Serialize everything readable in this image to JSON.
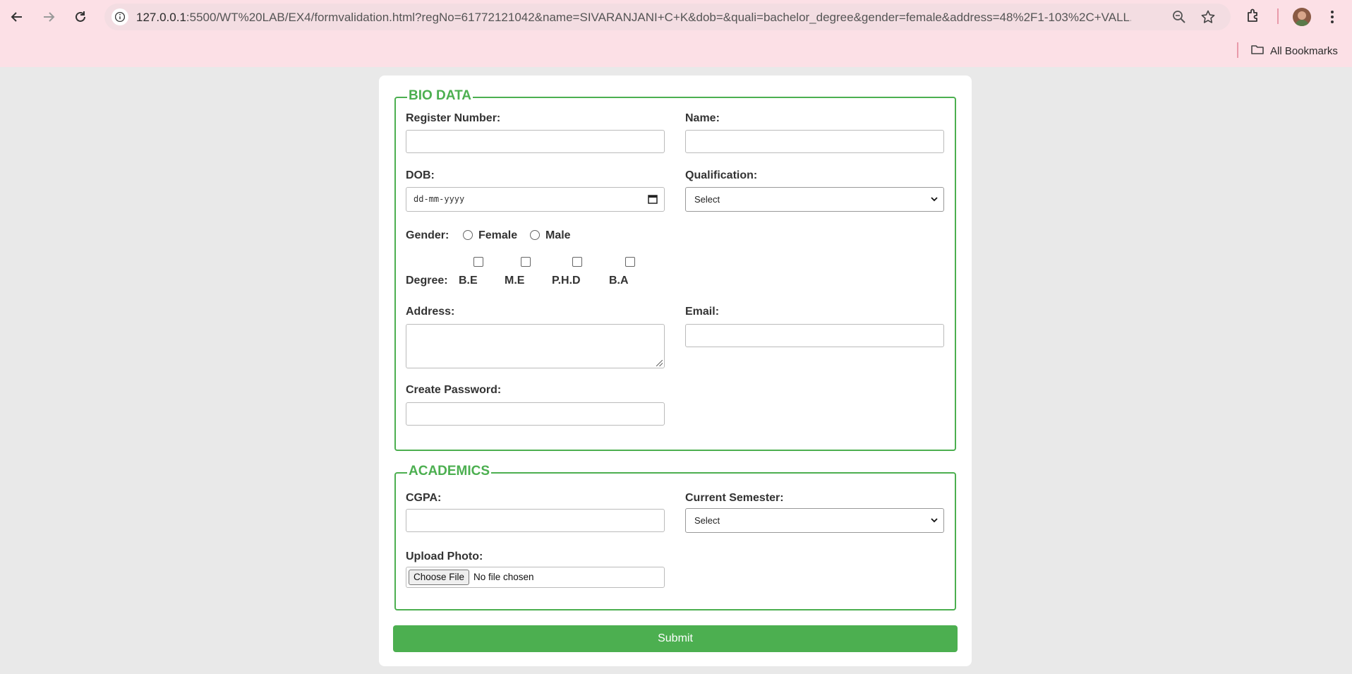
{
  "browser": {
    "url_host": "127.0.0.1",
    "url_rest": ":5500/WT%20LAB/EX4/formvalidation.html?regNo=61772121042&name=SIVARANJANI+C+K&dob=&quali=bachelor_degree&gender=female&address=48%2F1-103%2C+VALL...",
    "bookmarks_label": "All Bookmarks",
    "icons": [
      "back-icon",
      "forward-icon",
      "reload-icon",
      "site-info-icon",
      "zoom-icon",
      "star-icon",
      "extensions-icon",
      "folder-icon",
      "kebab-menu-icon"
    ]
  },
  "form": {
    "biodata": {
      "legend": "BIO DATA",
      "register_label": "Register Number:",
      "register_value": "",
      "name_label": "Name:",
      "name_value": "",
      "dob_label": "DOB:",
      "dob_placeholder": "dd-mm-yyyy",
      "qualification_label": "Qualification:",
      "qualification_selected": "Select",
      "gender_label": "Gender:",
      "gender_options": [
        "Female",
        "Male"
      ],
      "degree_label": "Degree:",
      "degree_options": [
        "B.E",
        "M.E",
        "P.H.D",
        "B.A"
      ],
      "address_label": "Address:",
      "email_label": "Email:",
      "password_label": "Create Password:"
    },
    "academics": {
      "legend": "ACADEMICS",
      "cgpa_label": "CGPA:",
      "semester_label": "Current Semester:",
      "semester_selected": "Select",
      "photo_label": "Upload Photo:",
      "choose_file": "Choose File",
      "no_file": "No file chosen"
    },
    "submit_label": "Submit"
  }
}
